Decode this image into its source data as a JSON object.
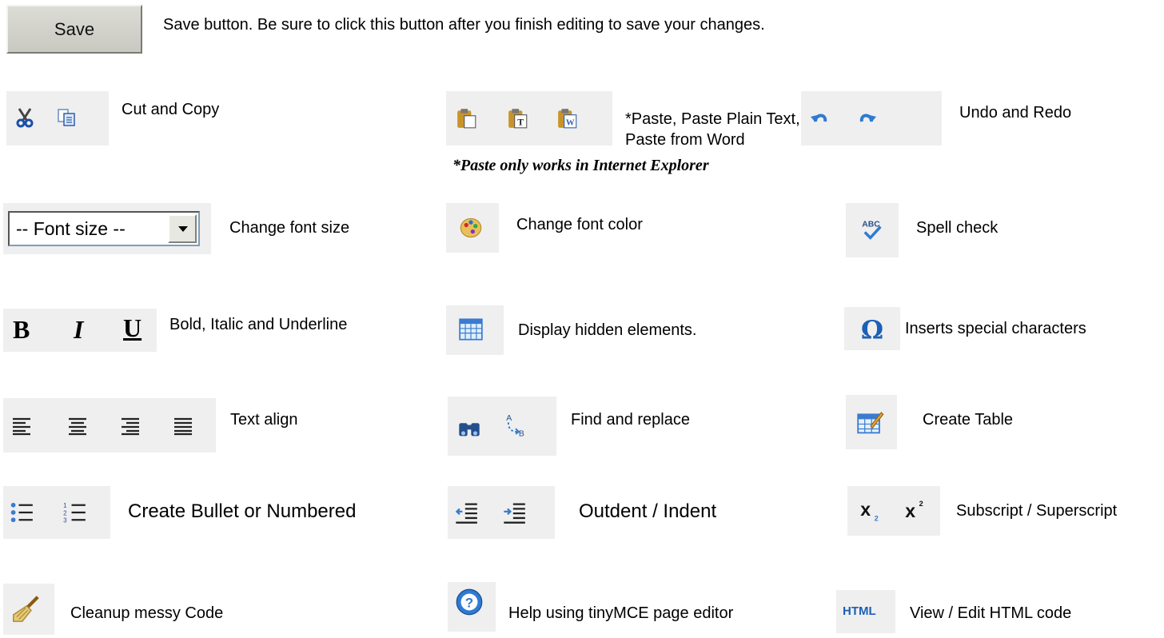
{
  "save": {
    "button_label": "Save",
    "description": "Save button. Be sure to click this button after you finish editing to save your changes."
  },
  "items": {
    "cut_copy": "Cut and Copy",
    "paste_line1": "*Paste, Paste Plain Text,",
    "paste_line2": "Paste from Word",
    "paste_note": "*Paste only works in Internet Explorer",
    "undo_redo": "Undo and Redo",
    "font_size_select": "-- Font size --",
    "font_size": "Change font size",
    "font_color": "Change font color",
    "spell_check": "Spell check",
    "bold_glyph": "B",
    "italic_glyph": "I",
    "underline_glyph": "U",
    "bold_italic_underline": "Bold, Italic and Underline",
    "hidden_elements": "Display hidden elements.",
    "special_chars": "Inserts special characters",
    "text_align": "Text align",
    "find_replace": "Find and replace",
    "create_table": "Create Table",
    "bullet_numbered": "Create Bullet or Numbered",
    "outdent_indent": "Outdent / Indent",
    "sub_superscript": "Subscript / Superscript",
    "cleanup": "Cleanup messy Code",
    "help": "Help using tinyMCE page editor",
    "html_label": "HTML",
    "view_html": "View / Edit HTML code"
  },
  "icons": [
    "scissors-icon",
    "copy-icon",
    "paste-icon",
    "paste-text-icon",
    "paste-word-icon",
    "undo-icon",
    "redo-icon",
    "font-color-icon",
    "spellcheck-icon",
    "hidden-elements-icon",
    "omega-icon",
    "align-left-icon",
    "align-center-icon",
    "align-right-icon",
    "align-justify-icon",
    "find-icon",
    "replace-icon",
    "table-icon",
    "bullet-list-icon",
    "numbered-list-icon",
    "outdent-icon",
    "indent-icon",
    "subscript-icon",
    "superscript-icon",
    "broom-icon",
    "help-icon",
    "html-icon"
  ]
}
